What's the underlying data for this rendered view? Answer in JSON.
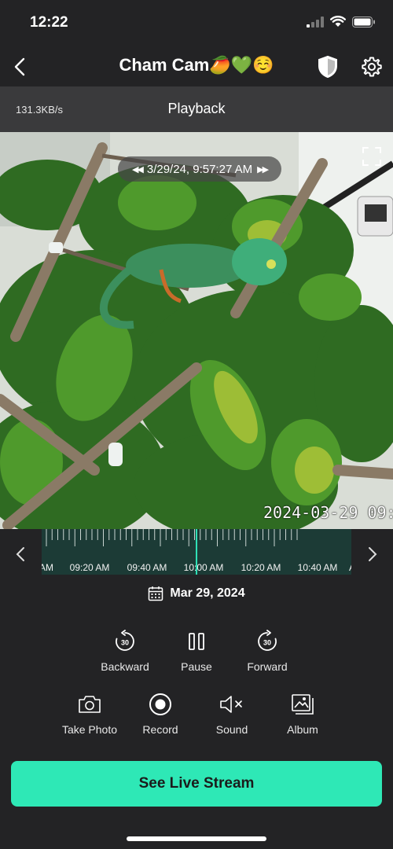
{
  "status_bar": {
    "time": "12:22",
    "icons": [
      "cellular-signal-icon",
      "wifi-icon",
      "battery-icon"
    ]
  },
  "header": {
    "title": "Cham Cam🥭💚☺️",
    "icons": [
      "back-chevron-icon",
      "shield-icon",
      "gear-icon"
    ]
  },
  "info_bar": {
    "speed": "131.3KB/s",
    "mode": "Playback"
  },
  "video": {
    "timestamp": "3/29/24, 9:57:27 AM",
    "osd_stamp": "2024-03-29 09:"
  },
  "timeline": {
    "labels": [
      "AM",
      "09:20 AM",
      "09:40 AM",
      "10:00 AM",
      "10:20 AM",
      "10:40 AM",
      "AM"
    ],
    "accent": "#2fe0b6",
    "background": "#1c3b36"
  },
  "date": {
    "value": "Mar 29, 2024",
    "icon": "calendar-icon"
  },
  "playback_controls": [
    {
      "label": "Backward",
      "icon": "rewind-30-icon"
    },
    {
      "label": "Pause",
      "icon": "pause-icon"
    },
    {
      "label": "Forward",
      "icon": "forward-30-icon"
    }
  ],
  "actions": [
    {
      "label": "Take Photo",
      "icon": "camera-icon"
    },
    {
      "label": "Record",
      "icon": "record-icon"
    },
    {
      "label": "Sound",
      "icon": "speaker-muted-icon"
    },
    {
      "label": "Album",
      "icon": "album-icon"
    }
  ],
  "live_button": {
    "label": "See Live Stream",
    "color": "#2ee8b6"
  },
  "colors": {
    "background": "#232325",
    "info_bar": "#3a3a3c"
  }
}
